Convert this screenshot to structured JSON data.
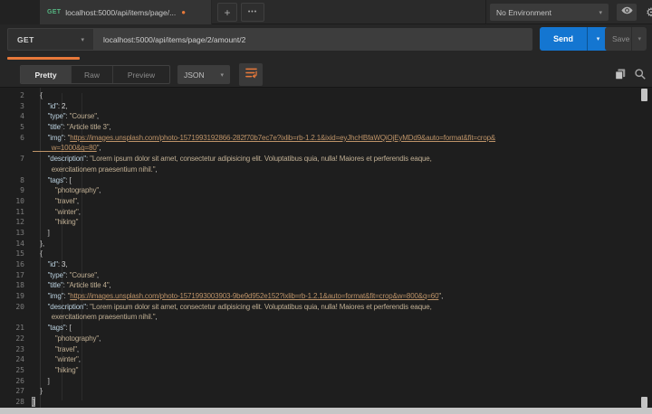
{
  "ui": {
    "caret": "▾",
    "dot": "●"
  },
  "colors": {
    "accent-orange": "#e8793a",
    "send-blue": "#1476d1",
    "method-green": "#55b380",
    "key-blue": "#b9cfdd",
    "string-tan": "#bfae93",
    "link-tan": "#bd9368"
  },
  "header": {
    "tab": {
      "method": "GET",
      "title": "localhost:5000/api/items/page/..."
    },
    "new_tab": "+",
    "more": "•••",
    "environment": {
      "selected": "No Environment"
    },
    "gear_glyph": "⚙"
  },
  "request": {
    "method": "GET",
    "url": "localhost:5000/api/items/page/2/amount/2",
    "send_label": "Send",
    "save_label": "Save"
  },
  "response_toolbar": {
    "tabs": [
      "Pretty",
      "Raw",
      "Preview"
    ],
    "active_tab": "Pretty",
    "format": "JSON"
  },
  "response": {
    "rows": [
      {
        "n": "2",
        "seg": [
          [
            "p",
            "    {"
          ]
        ]
      },
      {
        "n": "3",
        "seg": [
          [
            "k",
            "        \"id\""
          ],
          [
            "p",
            ": "
          ],
          [
            "num",
            "2"
          ],
          [
            "p",
            ","
          ]
        ]
      },
      {
        "n": "4",
        "seg": [
          [
            "k",
            "        \"type\""
          ],
          [
            "p",
            ": "
          ],
          [
            "s",
            "\"Course\""
          ],
          [
            "p",
            ","
          ]
        ]
      },
      {
        "n": "5",
        "seg": [
          [
            "k",
            "        \"title\""
          ],
          [
            "p",
            ": "
          ],
          [
            "s",
            "\"Article title 3\""
          ],
          [
            "p",
            ","
          ]
        ]
      },
      {
        "n": "6",
        "seg": [
          [
            "k",
            "        \"img\""
          ],
          [
            "p",
            ": "
          ],
          [
            "s",
            "\""
          ],
          [
            "l",
            "https://images.unsplash.com/photo-1571993192866-282f70b7ec7e?ixlib=rb-1.2.1&ixid=eyJhcHBfaWQiOjEyMDd9&auto=format&fit=crop&"
          ]
        ]
      },
      {
        "n": "",
        "seg": [
          [
            "l",
            "          w=1000&q=80"
          ],
          [
            "s",
            "\""
          ],
          [
            "p",
            ","
          ]
        ]
      },
      {
        "n": "7",
        "seg": [
          [
            "k",
            "        \"description\""
          ],
          [
            "p",
            ": "
          ],
          [
            "s",
            "\"Lorem ipsum dolor sit amet, consectetur adipisicing elit. Voluptatibus quia, nulla! Maiores et perferendis eaque,"
          ]
        ]
      },
      {
        "n": "",
        "seg": [
          [
            "s",
            "          exercitationem praesentium nihil.\""
          ],
          [
            "p",
            ","
          ]
        ]
      },
      {
        "n": "8",
        "seg": [
          [
            "k",
            "        \"tags\""
          ],
          [
            "p",
            ": ["
          ]
        ]
      },
      {
        "n": "9",
        "seg": [
          [
            "s",
            "            \"photography\""
          ],
          [
            "p",
            ","
          ]
        ]
      },
      {
        "n": "10",
        "seg": [
          [
            "s",
            "            \"travel\""
          ],
          [
            "p",
            ","
          ]
        ]
      },
      {
        "n": "11",
        "seg": [
          [
            "s",
            "            \"winter\""
          ],
          [
            "p",
            ","
          ]
        ]
      },
      {
        "n": "12",
        "seg": [
          [
            "s",
            "            \"hiking\""
          ]
        ]
      },
      {
        "n": "13",
        "seg": [
          [
            "p",
            "        ]"
          ]
        ]
      },
      {
        "n": "14",
        "seg": [
          [
            "p",
            "    },"
          ]
        ]
      },
      {
        "n": "15",
        "seg": [
          [
            "p",
            "    {"
          ]
        ]
      },
      {
        "n": "16",
        "seg": [
          [
            "k",
            "        \"id\""
          ],
          [
            "p",
            ": "
          ],
          [
            "num",
            "3"
          ],
          [
            "p",
            ","
          ]
        ]
      },
      {
        "n": "17",
        "seg": [
          [
            "k",
            "        \"type\""
          ],
          [
            "p",
            ": "
          ],
          [
            "s",
            "\"Course\""
          ],
          [
            "p",
            ","
          ]
        ]
      },
      {
        "n": "18",
        "seg": [
          [
            "k",
            "        \"title\""
          ],
          [
            "p",
            ": "
          ],
          [
            "s",
            "\"Article title 4\""
          ],
          [
            "p",
            ","
          ]
        ]
      },
      {
        "n": "19",
        "seg": [
          [
            "k",
            "        \"img\""
          ],
          [
            "p",
            ": "
          ],
          [
            "s",
            "\""
          ],
          [
            "l",
            "https://images.unsplash.com/photo-1571993003903-9be9d952e152?ixlib=rb-1.2.1&auto=format&fit=crop&w=800&q=60"
          ],
          [
            "s",
            "\""
          ],
          [
            "p",
            ","
          ]
        ]
      },
      {
        "n": "20",
        "seg": [
          [
            "k",
            "        \"description\""
          ],
          [
            "p",
            ": "
          ],
          [
            "s",
            "\"Lorem ipsum dolor sit amet, consectetur adipisicing elit. Voluptatibus quia, nulla! Maiores et perferendis eaque,"
          ]
        ]
      },
      {
        "n": "",
        "seg": [
          [
            "s",
            "          exercitationem praesentium nihil.\""
          ],
          [
            "p",
            ","
          ]
        ]
      },
      {
        "n": "21",
        "seg": [
          [
            "k",
            "        \"tags\""
          ],
          [
            "p",
            ": ["
          ]
        ]
      },
      {
        "n": "22",
        "seg": [
          [
            "s",
            "            \"photography\""
          ],
          [
            "p",
            ","
          ]
        ]
      },
      {
        "n": "23",
        "seg": [
          [
            "s",
            "            \"travel\""
          ],
          [
            "p",
            ","
          ]
        ]
      },
      {
        "n": "24",
        "seg": [
          [
            "s",
            "            \"winter\""
          ],
          [
            "p",
            ","
          ]
        ]
      },
      {
        "n": "25",
        "seg": [
          [
            "s",
            "            \"hiking\""
          ]
        ]
      },
      {
        "n": "26",
        "seg": [
          [
            "p",
            "        ]"
          ]
        ]
      },
      {
        "n": "27",
        "seg": [
          [
            "p",
            "    }"
          ]
        ]
      },
      {
        "n": "28",
        "seg": [
          [
            "hl",
            "]"
          ]
        ]
      }
    ]
  }
}
